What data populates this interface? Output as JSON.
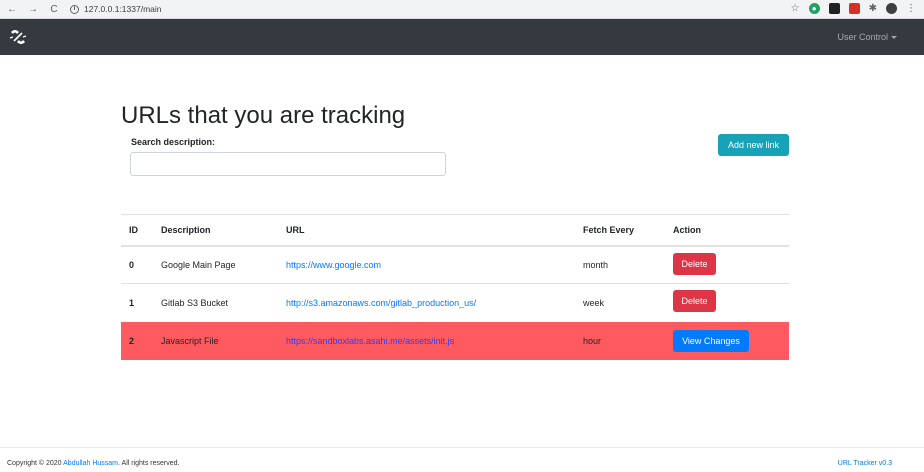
{
  "browser": {
    "url": "127.0.0.1:1337/main",
    "back_icon": "←",
    "forward_icon": "→",
    "reload_icon": "C"
  },
  "navbar": {
    "user_control_label": "User Control"
  },
  "page": {
    "title": "URLs that you are tracking",
    "search_label": "Search description:",
    "search_value": "",
    "add_button_label": "Add new link"
  },
  "table": {
    "headers": [
      "ID",
      "Description",
      "URL",
      "Fetch Every",
      "Action"
    ],
    "rows": [
      {
        "id": "0",
        "description": "Google Main Page",
        "url": "https://www.google.com",
        "fetch": "month",
        "action": "Delete"
      },
      {
        "id": "1",
        "description": "Gitlab S3 Bucket",
        "url": "http://s3.amazonaws.com/gitlab_production_us/",
        "fetch": "week",
        "action": "Delete"
      },
      {
        "id": "2",
        "description": "Javascript File",
        "url": "https://sandboxlabs.asahi.me/assets/init.js",
        "fetch": "hour",
        "action": "View Changes"
      }
    ]
  },
  "footer": {
    "copyright_prefix": "Copyright © 2020",
    "author": "Abdullah Hussam",
    "rights": ". All rights reserved.",
    "version": "URL Tracker v0.3"
  },
  "colors": {
    "navbar": "#343a40",
    "accent_teal": "#17a2b8",
    "danger": "#dc3545",
    "primary": "#007bff",
    "highlight_row": "#ff5a60"
  }
}
